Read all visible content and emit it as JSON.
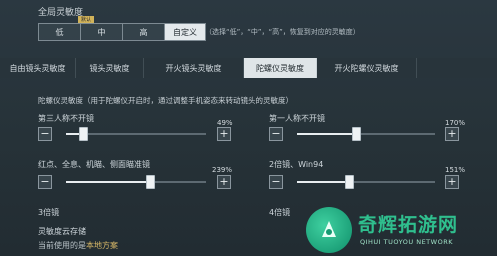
{
  "section_title": "全局灵敏度",
  "presets": {
    "tag": "默认",
    "options": [
      "低",
      "中",
      "高",
      "自定义"
    ],
    "active_index": 3,
    "hint": "（选择“低”，“中”，“高”，恢复到对应的灵敏度）"
  },
  "tabs": [
    "自由镜头灵敏度",
    "镜头灵敏度",
    "开火镜头灵敏度",
    "陀螺仪灵敏度",
    "开火陀螺仪灵敏度"
  ],
  "active_tab": 3,
  "description": "陀螺仪灵敏度（用于陀螺仪开启时，通过调整手机姿态来转动镜头的灵敏度）",
  "sliders": [
    {
      "label": "第三人称不开镜",
      "value_text": "49%",
      "value": 49,
      "max": 400
    },
    {
      "label": "第一人称不开镜",
      "value_text": "170%",
      "value": 170,
      "max": 400
    },
    {
      "label": "红点、全息、机瞄、侧面瞄准镜",
      "value_text": "239%",
      "value": 239,
      "max": 400
    },
    {
      "label": "2倍镜、Win94",
      "value_text": "151%",
      "value": 151,
      "max": 400
    }
  ],
  "partial_labels": [
    "3倍镜",
    "4倍镜"
  ],
  "stepper": {
    "minus": "−",
    "plus": "+"
  },
  "cloud": {
    "title": "灵敏度云存储",
    "current_prefix": "当前使用的是",
    "current_value": "本地方案"
  },
  "watermark": {
    "title": "奇辉拓游网",
    "subtitle": "QIHUI TUOYOU NETWORK"
  },
  "colors": {
    "accent": "#dfe5e8",
    "highlight": "#d7b868",
    "watermark": "#2fbf8e"
  }
}
